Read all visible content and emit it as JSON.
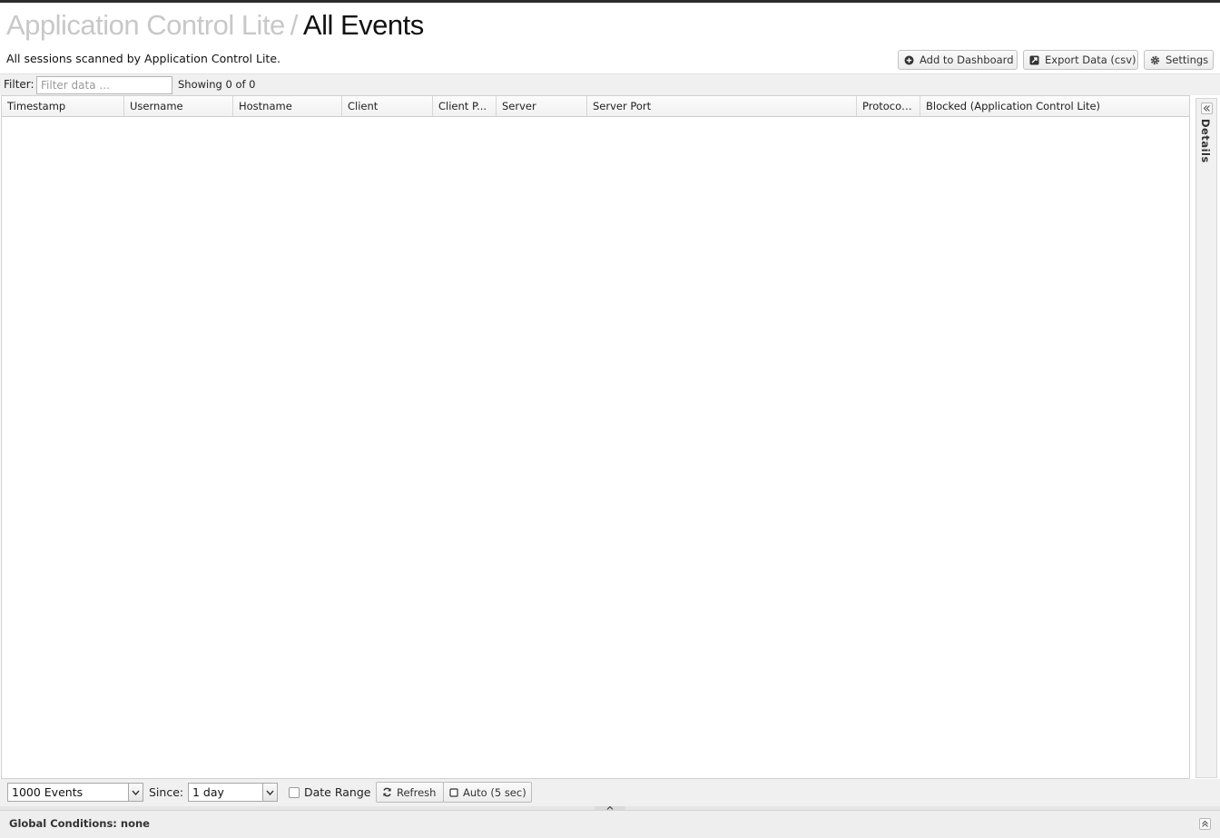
{
  "header": {
    "app_name": "Application Control Lite",
    "separator": "/",
    "report_name": "All Events",
    "description": "All sessions scanned by Application Control Lite."
  },
  "toolbar": {
    "add_to_dashboard_label": "Add to Dashboard",
    "export_label": "Export Data (csv)",
    "settings_label": "Settings"
  },
  "filter": {
    "label": "Filter:",
    "placeholder": "Filter data ...",
    "value": "",
    "showing": "Showing 0 of 0"
  },
  "grid": {
    "columns": [
      "Timestamp",
      "Username",
      "Hostname",
      "Client",
      "Client P...",
      "Server",
      "Server Port",
      "Protocol...",
      "Blocked (Application Control Lite)"
    ],
    "rows": []
  },
  "details_panel": {
    "label": "Details"
  },
  "bottom": {
    "events_limit": "1000 Events",
    "since_label": "Since:",
    "since_value": "1 day",
    "date_range_label": "Date Range",
    "date_range_checked": false,
    "refresh_label": "Refresh",
    "auto_label": "Auto (5 sec)"
  },
  "global_conditions": {
    "text": "Global Conditions: none"
  }
}
